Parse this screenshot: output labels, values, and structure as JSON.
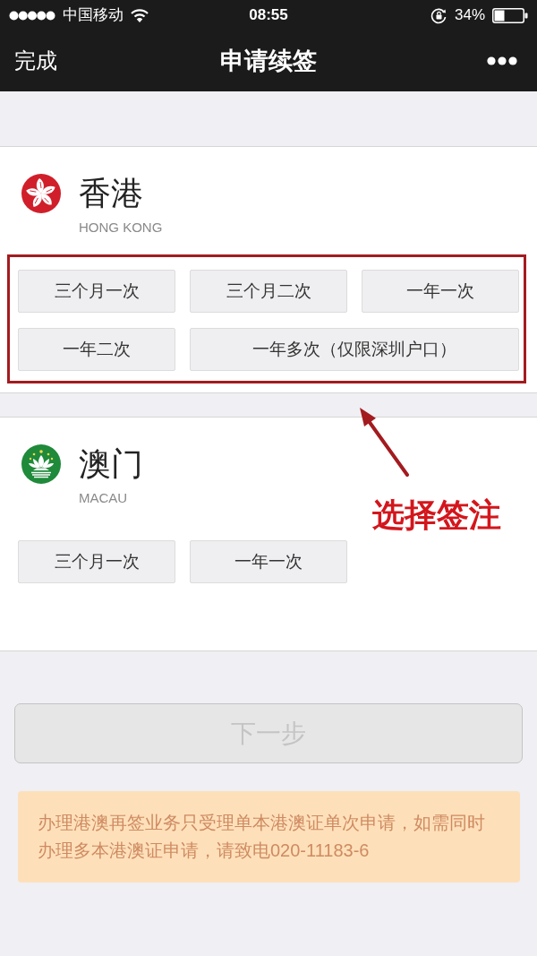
{
  "status_bar": {
    "carrier": "中国移动",
    "time": "08:55",
    "battery": "34%"
  },
  "nav_bar": {
    "left_button": "完成",
    "title": "申请续签"
  },
  "regions": [
    {
      "name": "香港",
      "subtitle": "HONG KONG",
      "highlighted": true,
      "options": [
        {
          "label": "三个月一次",
          "selected": false
        },
        {
          "label": "三个月二次",
          "selected": false
        },
        {
          "label": "一年一次",
          "selected": false
        },
        {
          "label": "一年二次",
          "selected": false
        },
        {
          "label": "一年多次（仅限深圳户口）",
          "selected": false
        }
      ]
    },
    {
      "name": "澳门",
      "subtitle": "MACAU",
      "highlighted": false,
      "options": [
        {
          "label": "三个月一次",
          "selected": false
        },
        {
          "label": "一年一次",
          "selected": false
        }
      ]
    }
  ],
  "annotation": {
    "label": "选择签注"
  },
  "next_button": {
    "label": "下一步",
    "disabled": true
  },
  "notice": "办理港澳再签业务只受理单本港澳证单次申请，如需同时办理多本港澳证申请，请致电020-11183-6"
}
